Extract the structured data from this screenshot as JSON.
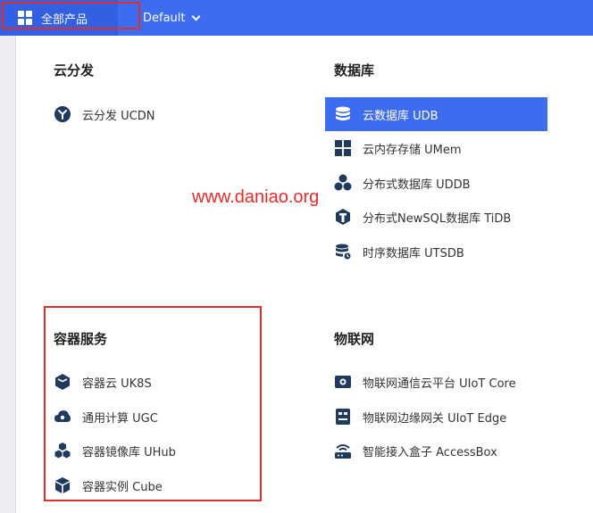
{
  "topbar": {
    "all_products_label": "全部产品",
    "project_label": "Default"
  },
  "watermark": "www.daniao.org",
  "sections": {
    "cdn": {
      "title": "云分发",
      "items": [
        {
          "label": "云分发 UCDN",
          "icon": "cdn-icon"
        }
      ]
    },
    "database": {
      "title": "数据库",
      "items": [
        {
          "label": "云数据库 UDB",
          "icon": "database-icon",
          "active": true
        },
        {
          "label": "云内存存储 UMem",
          "icon": "memory-grid-icon"
        },
        {
          "label": "分布式数据库 UDDB",
          "icon": "distributed-db-icon"
        },
        {
          "label": "分布式NewSQL数据库 TiDB",
          "icon": "tidb-icon"
        },
        {
          "label": "时序数据库 UTSDB",
          "icon": "timeseries-db-icon"
        }
      ]
    },
    "container": {
      "title": "容器服务",
      "items": [
        {
          "label": "容器云 UK8S",
          "icon": "container-cloud-icon"
        },
        {
          "label": "通用计算 UGC",
          "icon": "compute-icon"
        },
        {
          "label": "容器镜像库 UHub",
          "icon": "image-registry-icon"
        },
        {
          "label": "容器实例 Cube",
          "icon": "cube-icon"
        }
      ]
    },
    "iot": {
      "title": "物联网",
      "items": [
        {
          "label": "物联网通信云平台 UIoT Core",
          "icon": "iot-core-icon"
        },
        {
          "label": "物联网边缘网关 UIoT Edge",
          "icon": "iot-edge-icon"
        },
        {
          "label": "智能接入盒子 AccessBox",
          "icon": "access-box-icon"
        }
      ]
    }
  },
  "colors": {
    "topbar": "#3c6cf0",
    "active_item": "#3c6cf0",
    "icon": "#1f3a5c",
    "highlight_border": "#e22d2d"
  }
}
